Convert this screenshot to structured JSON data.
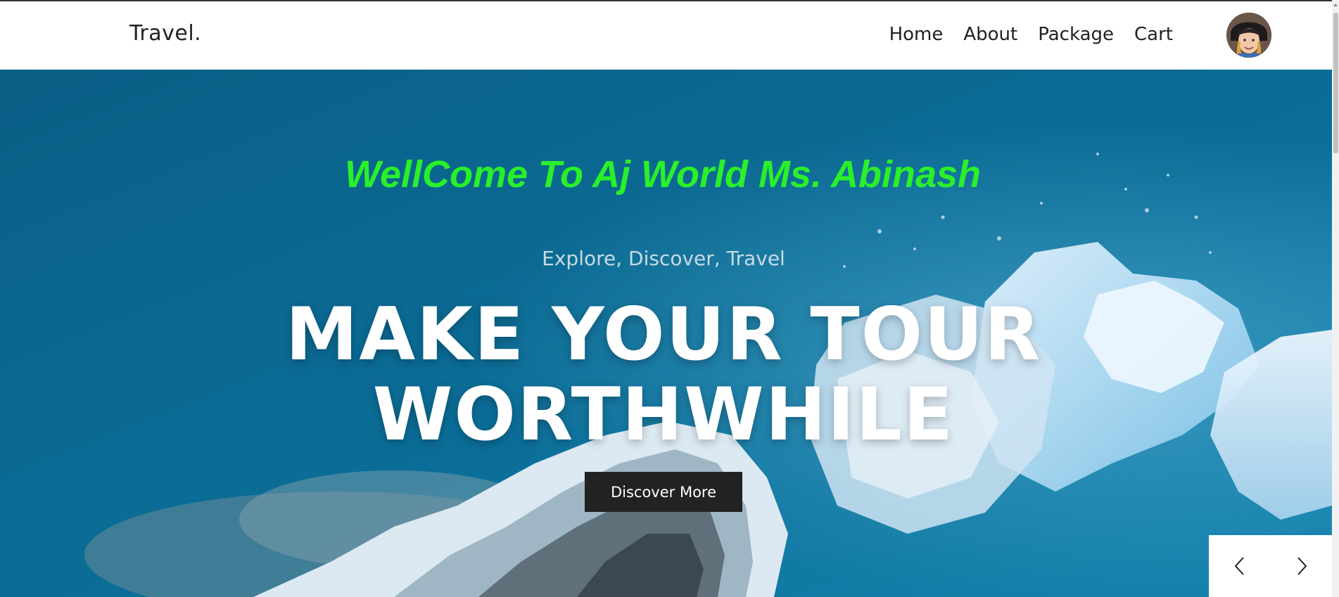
{
  "header": {
    "brand": "Travel.",
    "nav_items": [
      {
        "label": "Home"
      },
      {
        "label": "About"
      },
      {
        "label": "Package"
      },
      {
        "label": "Cart"
      }
    ],
    "avatar_icon": "user-avatar-icon"
  },
  "hero": {
    "welcome": "WellCome To Aj World Ms. Abinash",
    "tagline": "Explore, Discover, Travel",
    "headline": "MAKE YOUR TOUR WORTHWHILE",
    "cta_label": "Discover More",
    "prev_icon": "chevron-left-icon",
    "next_icon": "chevron-right-icon"
  },
  "colors": {
    "welcome_text": "#2af02a",
    "cta_background": "#222222",
    "ocean": "#0b6a93"
  }
}
